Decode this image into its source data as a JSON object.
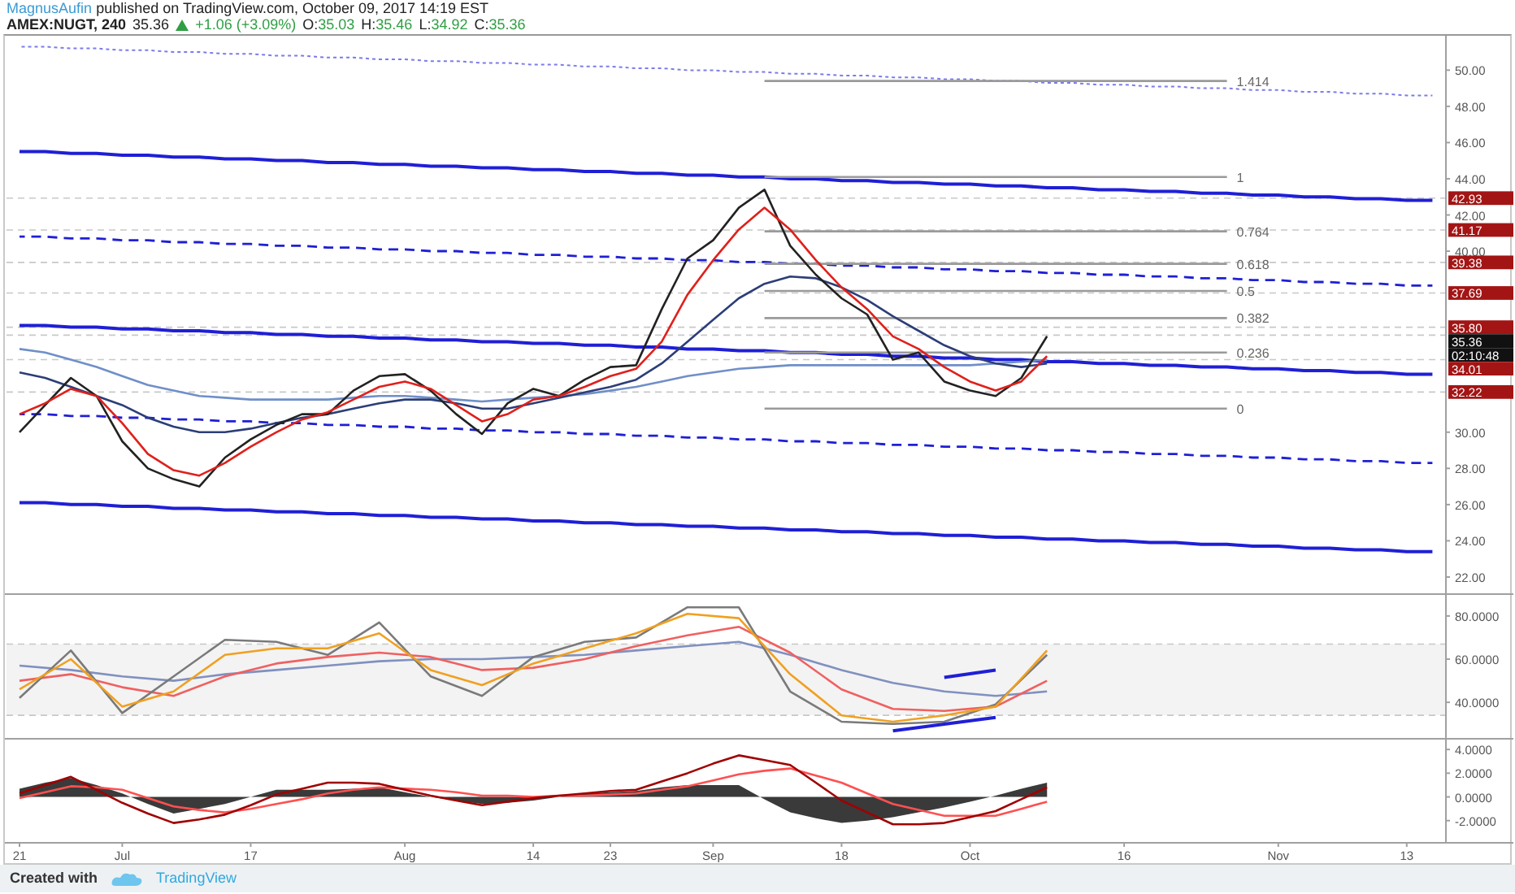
{
  "header": {
    "author": "MagnusAufin",
    "published": "published on TradingView.com, October 09, 2017 14:19 EST",
    "symbol": "AMEX:NUGT, 240",
    "last": "35.36",
    "change": "+1.06 (+3.09%)",
    "ohlc": [
      {
        "label": "O:",
        "value": "35.03"
      },
      {
        "label": "H:",
        "value": "35.46"
      },
      {
        "label": "L:",
        "value": "34.92"
      },
      {
        "label": "C:",
        "value": "35.36"
      }
    ]
  },
  "price_chart": {
    "tags": [
      {
        "kind": "level"
      },
      {
        "kind": "level"
      },
      {
        "kind": "level"
      },
      {
        "kind": "level"
      },
      {
        "kind": "level"
      },
      {
        "kind": "last"
      },
      {
        "kind": "level"
      },
      {
        "kind": "level"
      }
    ],
    "countdown": {
      "text": "02:10:48"
    },
    "chart_data": {
      "type": "line",
      "ylim": [
        21.1,
        51.9
      ],
      "yticks": [
        {
          "value": 22,
          "label": "22.00"
        },
        {
          "value": 24,
          "label": "24.00"
        },
        {
          "value": 26,
          "label": "26.00"
        },
        {
          "value": 28,
          "label": "28.00"
        },
        {
          "value": 30,
          "label": "30.00"
        },
        {
          "value": 40,
          "label": "40.00"
        },
        {
          "value": 42,
          "label": "42.00"
        },
        {
          "value": 44,
          "label": "44.00"
        },
        {
          "value": 46,
          "label": "46.00"
        },
        {
          "value": 48,
          "label": "48.00"
        },
        {
          "value": 50,
          "label": "50.00"
        }
      ],
      "categories": [
        null,
        null,
        null,
        null,
        null,
        null,
        null,
        null,
        null,
        null,
        null,
        null,
        null,
        null,
        null,
        null,
        null,
        null,
        null,
        null,
        null,
        null,
        null,
        null,
        null,
        null,
        null,
        null,
        null,
        null,
        null,
        null,
        null,
        null,
        null,
        null,
        null,
        null,
        null,
        null,
        null,
        null,
        null,
        null,
        null,
        null,
        null,
        null,
        null,
        null,
        null,
        null,
        null,
        null,
        null,
        null
      ],
      "series": [
        {
          "color": "#7b7bea",
          "line_style": "dotted",
          "values": [
            51.3,
            51.3,
            51.2,
            51.2,
            51.1,
            51.1,
            51.0,
            51.0,
            50.9,
            50.9,
            50.8,
            50.8,
            50.7,
            50.7,
            50.6,
            50.6,
            50.5,
            50.5,
            50.4,
            50.4,
            50.3,
            50.3,
            50.2,
            50.2,
            50.1,
            50.1,
            50.0,
            50.0,
            49.9,
            49.9,
            49.8,
            49.8,
            49.7,
            49.7,
            49.6,
            49.6,
            49.5,
            49.5,
            49.4,
            49.4,
            49.3,
            49.3,
            49.2,
            49.2,
            49.1,
            49.1,
            49.0,
            49.0,
            48.9,
            48.9,
            48.8,
            48.8,
            48.7,
            48.7,
            48.6,
            48.6
          ]
        },
        {
          "color": "#1f1fd6",
          "line_style": "solid",
          "values": [
            45.5,
            45.5,
            45.4,
            45.4,
            45.3,
            45.3,
            45.2,
            45.2,
            45.1,
            45.1,
            45.0,
            45.0,
            44.9,
            44.9,
            44.8,
            44.8,
            44.7,
            44.7,
            44.6,
            44.6,
            44.5,
            44.5,
            44.4,
            44.4,
            44.3,
            44.3,
            44.2,
            44.2,
            44.1,
            44.1,
            44.0,
            44.0,
            43.9,
            43.9,
            43.8,
            43.8,
            43.7,
            43.7,
            43.6,
            43.6,
            43.5,
            43.5,
            43.4,
            43.4,
            43.3,
            43.3,
            43.2,
            43.2,
            43.1,
            43.1,
            43.0,
            43.0,
            42.9,
            42.9,
            42.8,
            42.8
          ]
        },
        {
          "color": "#1f1fd6",
          "line_style": "dashed",
          "values": [
            40.8,
            40.8,
            40.7,
            40.7,
            40.6,
            40.6,
            40.5,
            40.5,
            40.4,
            40.4,
            40.3,
            40.3,
            40.2,
            40.2,
            40.1,
            40.1,
            40.0,
            40.0,
            39.9,
            39.9,
            39.8,
            39.8,
            39.7,
            39.7,
            39.6,
            39.6,
            39.5,
            39.5,
            39.4,
            39.4,
            39.3,
            39.3,
            39.2,
            39.2,
            39.1,
            39.1,
            39.0,
            39.0,
            38.9,
            38.9,
            38.8,
            38.8,
            38.7,
            38.7,
            38.6,
            38.6,
            38.5,
            38.5,
            38.4,
            38.4,
            38.3,
            38.3,
            38.2,
            38.2,
            38.1,
            38.1
          ]
        },
        {
          "color": "#1f1fd6",
          "line_style": "solid",
          "values": [
            35.9,
            35.9,
            35.8,
            35.8,
            35.7,
            35.7,
            35.6,
            35.6,
            35.5,
            35.5,
            35.4,
            35.4,
            35.3,
            35.3,
            35.2,
            35.2,
            35.1,
            35.1,
            35.0,
            35.0,
            34.9,
            34.9,
            34.8,
            34.8,
            34.7,
            34.7,
            34.6,
            34.6,
            34.5,
            34.5,
            34.4,
            34.4,
            34.3,
            34.3,
            34.2,
            34.2,
            34.1,
            34.1,
            34.0,
            34.0,
            33.9,
            33.9,
            33.8,
            33.8,
            33.7,
            33.7,
            33.6,
            33.6,
            33.5,
            33.5,
            33.4,
            33.4,
            33.3,
            33.3,
            33.2,
            33.2
          ]
        },
        {
          "color": "#1f1fd6",
          "line_style": "dashed",
          "values": [
            31.0,
            31.0,
            30.9,
            30.9,
            30.8,
            30.8,
            30.7,
            30.7,
            30.6,
            30.6,
            30.5,
            30.5,
            30.4,
            30.4,
            30.3,
            30.3,
            30.2,
            30.2,
            30.1,
            30.1,
            30.0,
            30.0,
            29.9,
            29.9,
            29.8,
            29.8,
            29.7,
            29.7,
            29.6,
            29.6,
            29.5,
            29.5,
            29.4,
            29.4,
            29.3,
            29.3,
            29.2,
            29.2,
            29.1,
            29.1,
            29.0,
            29.0,
            28.9,
            28.9,
            28.8,
            28.8,
            28.7,
            28.7,
            28.6,
            28.6,
            28.5,
            28.5,
            28.4,
            28.4,
            28.3,
            28.3
          ]
        },
        {
          "color": "#1f1fd6",
          "line_style": "solid",
          "values": [
            26.1,
            26.1,
            26.0,
            26.0,
            25.9,
            25.9,
            25.8,
            25.8,
            25.7,
            25.7,
            25.6,
            25.6,
            25.5,
            25.5,
            25.4,
            25.4,
            25.3,
            25.3,
            25.2,
            25.2,
            25.1,
            25.1,
            25.0,
            25.0,
            24.9,
            24.9,
            24.8,
            24.8,
            24.7,
            24.7,
            24.6,
            24.6,
            24.5,
            24.5,
            24.4,
            24.4,
            24.3,
            24.3,
            24.2,
            24.2,
            24.1,
            24.1,
            24.0,
            24.0,
            23.9,
            23.9,
            23.8,
            23.8,
            23.7,
            23.7,
            23.6,
            23.6,
            23.5,
            23.5,
            23.4,
            23.4
          ]
        },
        {
          "color": "#9a9a9a",
          "values": [
            null,
            null,
            null,
            null,
            null,
            null,
            null,
            null,
            null,
            null,
            null,
            null,
            null,
            null,
            null,
            null,
            null,
            null,
            null,
            null,
            null,
            null,
            null,
            null,
            null,
            null,
            null,
            null,
            null,
            49.4,
            49.4,
            49.4,
            49.4,
            49.4,
            49.4,
            49.4,
            49.4,
            49.4,
            49.4,
            49.4,
            49.4,
            49.4,
            49.4,
            49.4,
            49.4,
            49.4,
            49.4,
            49.4,
            null,
            null,
            null,
            null,
            null,
            null,
            null,
            null
          ]
        },
        {
          "color": "#9a9a9a",
          "values": [
            null,
            null,
            null,
            null,
            null,
            null,
            null,
            null,
            null,
            null,
            null,
            null,
            null,
            null,
            null,
            null,
            null,
            null,
            null,
            null,
            null,
            null,
            null,
            null,
            null,
            null,
            null,
            null,
            null,
            44.1,
            44.1,
            44.1,
            44.1,
            44.1,
            44.1,
            44.1,
            44.1,
            44.1,
            44.1,
            44.1,
            44.1,
            44.1,
            44.1,
            44.1,
            44.1,
            44.1,
            44.1,
            44.1,
            null,
            null,
            null,
            null,
            null,
            null,
            null,
            null
          ]
        },
        {
          "color": "#9a9a9a",
          "values": [
            null,
            null,
            null,
            null,
            null,
            null,
            null,
            null,
            null,
            null,
            null,
            null,
            null,
            null,
            null,
            null,
            null,
            null,
            null,
            null,
            null,
            null,
            null,
            null,
            null,
            null,
            null,
            null,
            null,
            41.1,
            41.1,
            41.1,
            41.1,
            41.1,
            41.1,
            41.1,
            41.1,
            41.1,
            41.1,
            41.1,
            41.1,
            41.1,
            41.1,
            41.1,
            41.1,
            41.1,
            41.1,
            41.1,
            null,
            null,
            null,
            null,
            null,
            null,
            null,
            null
          ]
        },
        {
          "color": "#9a9a9a",
          "values": [
            null,
            null,
            null,
            null,
            null,
            null,
            null,
            null,
            null,
            null,
            null,
            null,
            null,
            null,
            null,
            null,
            null,
            null,
            null,
            null,
            null,
            null,
            null,
            null,
            null,
            null,
            null,
            null,
            null,
            39.3,
            39.3,
            39.3,
            39.3,
            39.3,
            39.3,
            39.3,
            39.3,
            39.3,
            39.3,
            39.3,
            39.3,
            39.3,
            39.3,
            39.3,
            39.3,
            39.3,
            39.3,
            39.3,
            null,
            null,
            null,
            null,
            null,
            null,
            null,
            null
          ]
        },
        {
          "color": "#9a9a9a",
          "values": [
            null,
            null,
            null,
            null,
            null,
            null,
            null,
            null,
            null,
            null,
            null,
            null,
            null,
            null,
            null,
            null,
            null,
            null,
            null,
            null,
            null,
            null,
            null,
            null,
            null,
            null,
            null,
            null,
            null,
            37.8,
            37.8,
            37.8,
            37.8,
            37.8,
            37.8,
            37.8,
            37.8,
            37.8,
            37.8,
            37.8,
            37.8,
            37.8,
            37.8,
            37.8,
            37.8,
            37.8,
            37.8,
            37.8,
            null,
            null,
            null,
            null,
            null,
            null,
            null,
            null
          ]
        },
        {
          "color": "#9a9a9a",
          "values": [
            null,
            null,
            null,
            null,
            null,
            null,
            null,
            null,
            null,
            null,
            null,
            null,
            null,
            null,
            null,
            null,
            null,
            null,
            null,
            null,
            null,
            null,
            null,
            null,
            null,
            null,
            null,
            null,
            null,
            36.3,
            36.3,
            36.3,
            36.3,
            36.3,
            36.3,
            36.3,
            36.3,
            36.3,
            36.3,
            36.3,
            36.3,
            36.3,
            36.3,
            36.3,
            36.3,
            36.3,
            36.3,
            36.3,
            null,
            null,
            null,
            null,
            null,
            null,
            null,
            null
          ]
        },
        {
          "color": "#9a9a9a",
          "values": [
            null,
            null,
            null,
            null,
            null,
            null,
            null,
            null,
            null,
            null,
            null,
            null,
            null,
            null,
            null,
            null,
            null,
            null,
            null,
            null,
            null,
            null,
            null,
            null,
            null,
            null,
            null,
            null,
            null,
            34.4,
            34.4,
            34.4,
            34.4,
            34.4,
            34.4,
            34.4,
            34.4,
            34.4,
            34.4,
            34.4,
            34.4,
            34.4,
            34.4,
            34.4,
            34.4,
            34.4,
            34.4,
            34.4,
            null,
            null,
            null,
            null,
            null,
            null,
            null,
            null
          ]
        },
        {
          "color": "#9a9a9a",
          "values": [
            null,
            null,
            null,
            null,
            null,
            null,
            null,
            null,
            null,
            null,
            null,
            null,
            null,
            null,
            null,
            null,
            null,
            null,
            null,
            null,
            null,
            null,
            null,
            null,
            null,
            null,
            null,
            null,
            null,
            31.3,
            31.3,
            31.3,
            31.3,
            31.3,
            31.3,
            31.3,
            31.3,
            31.3,
            31.3,
            31.3,
            31.3,
            31.3,
            31.3,
            31.3,
            31.3,
            31.3,
            31.3,
            31.3,
            null,
            null,
            null,
            null,
            null,
            null,
            null,
            null
          ]
        },
        {
          "color": "#6f8fc8",
          "values": [
            34.6,
            34.4,
            34.0,
            33.6,
            33.1,
            32.6,
            32.3,
            32.0,
            31.9,
            31.8,
            31.8,
            31.8,
            31.8,
            31.9,
            32.0,
            32.0,
            31.9,
            31.8,
            31.7,
            31.8,
            31.9,
            32.0,
            32.1,
            32.3,
            32.5,
            32.8,
            33.1,
            33.3,
            33.5,
            33.6,
            33.7,
            33.7,
            33.7,
            33.7,
            33.7,
            33.7,
            33.7,
            33.7,
            33.8,
            33.9,
            34.0,
            null,
            null,
            null,
            null,
            null,
            null,
            null,
            null,
            null,
            null,
            null,
            null,
            null,
            null,
            null
          ]
        },
        {
          "color": "#2c3e78",
          "values": [
            33.3,
            33.0,
            32.5,
            32.0,
            31.5,
            30.8,
            30.3,
            30.0,
            30.0,
            30.2,
            30.5,
            30.8,
            31.0,
            31.3,
            31.6,
            31.8,
            31.8,
            31.6,
            31.3,
            31.3,
            31.6,
            31.9,
            32.2,
            32.5,
            32.9,
            33.8,
            35.0,
            36.2,
            37.4,
            38.2,
            38.6,
            38.5,
            38.0,
            37.3,
            36.4,
            35.6,
            34.8,
            34.2,
            33.8,
            33.6,
            33.8,
            null,
            null,
            null,
            null,
            null,
            null,
            null,
            null,
            null,
            null,
            null,
            null,
            null,
            null,
            null
          ]
        },
        {
          "color": "#222222",
          "values": [
            30.0,
            31.5,
            33.0,
            32.0,
            29.5,
            28.0,
            27.4,
            27.0,
            28.6,
            29.6,
            30.4,
            31.0,
            31.0,
            32.3,
            33.1,
            33.2,
            32.3,
            31.0,
            29.9,
            31.6,
            32.4,
            32.0,
            32.9,
            33.6,
            33.7,
            36.8,
            39.6,
            40.6,
            42.4,
            43.4,
            40.3,
            38.7,
            37.4,
            36.5,
            34.0,
            34.4,
            32.8,
            32.3,
            32.0,
            33.0,
            35.3,
            null,
            null,
            null,
            null,
            null,
            null,
            null,
            null,
            null,
            null,
            null,
            null,
            null,
            null,
            null
          ]
        },
        {
          "color": "#e0201b",
          "values": [
            31.0,
            31.6,
            32.4,
            32.0,
            30.5,
            28.8,
            27.9,
            27.6,
            28.3,
            29.2,
            30.0,
            30.7,
            31.1,
            31.8,
            32.5,
            32.8,
            32.4,
            31.5,
            30.6,
            31.0,
            31.8,
            32.0,
            32.5,
            33.1,
            33.5,
            35.0,
            37.6,
            39.5,
            41.2,
            42.4,
            41.2,
            39.5,
            38.0,
            36.8,
            35.3,
            34.6,
            33.6,
            32.8,
            32.3,
            32.8,
            34.2,
            null,
            null,
            null,
            null,
            null,
            null,
            null,
            null,
            null,
            null,
            null,
            null,
            null,
            null,
            null
          ]
        }
      ],
      "annotations": [
        "1.414",
        "1",
        "0.764",
        "0.618",
        "0.5",
        "0.382",
        "0.236",
        "0"
      ],
      "ref_lines": [
        {
          "axis": "y",
          "value": 42.93,
          "label": "42.93"
        },
        {
          "axis": "y",
          "value": 41.17,
          "label": "41.17"
        },
        {
          "axis": "y",
          "value": 39.38,
          "label": "39.38"
        },
        {
          "axis": "y",
          "value": 37.69,
          "label": "37.69"
        },
        {
          "axis": "y",
          "value": 35.8,
          "label": "35.80"
        },
        {
          "axis": "y",
          "value": 35.36,
          "label": "35.36"
        },
        {
          "axis": "y",
          "value": 34.01,
          "label": "34.01"
        },
        {
          "axis": "y",
          "value": 32.22,
          "label": "32.22"
        }
      ]
    }
  },
  "oscillator": {
    "chart_data": {
      "type": "line",
      "ylim": [
        23.5,
        90.5
      ],
      "yticks": [
        {
          "value": 40,
          "label": "40.0000"
        },
        {
          "value": 60,
          "label": "60.0000"
        },
        {
          "value": 80,
          "label": "80.0000"
        }
      ],
      "bands": [
        {
          "axis": "y",
          "from": 34,
          "to": 67
        }
      ],
      "ref_lines": [
        {
          "axis": "y",
          "value": 67
        },
        {
          "axis": "y",
          "value": 34
        }
      ],
      "categories": [
        null,
        null,
        null,
        null,
        null,
        null,
        null,
        null,
        null,
        null,
        null,
        null,
        null,
        null,
        null,
        null,
        null,
        null,
        null,
        null,
        null,
        null,
        null,
        null,
        null,
        null,
        null,
        null
      ],
      "series": [
        {
          "color": "#8090c0",
          "values": [
            57,
            55,
            52,
            50,
            53,
            55,
            57,
            59,
            60,
            60,
            61,
            62,
            64,
            66,
            68,
            62,
            55,
            49,
            45,
            43,
            45,
            null,
            null,
            null,
            null,
            null,
            null,
            null
          ]
        },
        {
          "color": "#f06060",
          "values": [
            50,
            53,
            47,
            43,
            52,
            58,
            61,
            63,
            61,
            55,
            56,
            60,
            66,
            71,
            75,
            63,
            46,
            37,
            36,
            38,
            50,
            null,
            null,
            null,
            null,
            null,
            null,
            null
          ]
        },
        {
          "color": "#7a7a7a",
          "values": [
            42,
            64,
            35,
            52,
            69,
            68,
            62,
            77,
            52,
            43,
            61,
            68,
            70,
            84,
            84,
            45,
            31,
            30,
            31,
            39,
            62,
            null,
            null,
            null,
            null,
            null,
            null,
            null
          ]
        },
        {
          "color": "#f0a020",
          "values": [
            46,
            60,
            38,
            45,
            62,
            65,
            65,
            72,
            55,
            48,
            58,
            65,
            72,
            81,
            79,
            53,
            34,
            31,
            34,
            38,
            64,
            null,
            null,
            null,
            null,
            null,
            null,
            null
          ]
        },
        {
          "color": "#1f1fd6",
          "line_style": "solid",
          "values": [
            null,
            null,
            null,
            null,
            null,
            null,
            null,
            null,
            null,
            null,
            null,
            null,
            null,
            null,
            null,
            null,
            null,
            null,
            51.5,
            55,
            null,
            null,
            null,
            null,
            null,
            null,
            null,
            null
          ]
        },
        {
          "color": "#1f1fd6",
          "line_style": "solid",
          "values": [
            null,
            null,
            null,
            null,
            null,
            null,
            null,
            null,
            null,
            null,
            null,
            null,
            null,
            null,
            null,
            null,
            null,
            26.8,
            29.9,
            33.0,
            null,
            null,
            null,
            null,
            null,
            null,
            null,
            null
          ]
        }
      ]
    }
  },
  "macd": {
    "chart_data": {
      "type": "line",
      "ylim": [
        -3.8,
        4.97
      ],
      "yticks": [
        {
          "value": -2,
          "label": "-2.0000"
        },
        {
          "value": 0,
          "label": "0.0000"
        },
        {
          "value": 2,
          "label": "2.0000"
        },
        {
          "value": 4,
          "label": "4.0000"
        }
      ],
      "categories": [
        "21",
        null,
        null,
        null,
        "Jul",
        null,
        null,
        null,
        null,
        "17",
        null,
        null,
        null,
        null,
        null,
        "Aug",
        null,
        null,
        null,
        null,
        "14",
        null,
        null,
        "23",
        null,
        null,
        null,
        "Sep",
        null,
        null,
        null,
        null,
        "18",
        null,
        null,
        null,
        null,
        "Oct",
        null,
        null,
        null,
        null,
        null,
        "16",
        null,
        null,
        null,
        null,
        null,
        "Nov",
        null,
        null,
        null,
        null,
        "13",
        null
      ],
      "series": [
        {
          "type": "area",
          "color": "#3a3a3a",
          "values": [
            0.7,
            1.2,
            1.6,
            1.0,
            0.3,
            -0.6,
            -1.4,
            -1.0,
            -0.6,
            0,
            0.6,
            0.6,
            0.6,
            0.7,
            0.8,
            0.4,
            0,
            -0.3,
            -0.6,
            -0.5,
            -0.3,
            0,
            0.3,
            0.4,
            0.5,
            0.8,
            1.0,
            1.0,
            1.0,
            -0.2,
            -1.3,
            -1.8,
            -2.2,
            -2.0,
            -1.7,
            -1.3,
            -0.9,
            -0.4,
            0.1,
            0.7,
            1.2,
            null,
            null,
            null,
            null,
            null,
            null,
            null,
            null,
            null,
            null,
            null,
            null,
            null,
            null,
            null
          ]
        },
        {
          "color": "#ff5050",
          "values": [
            -0.1,
            0.4,
            0.9,
            0.8,
            0.6,
            -0.1,
            -0.8,
            -1.1,
            -1.3,
            -1.0,
            -0.6,
            -0.2,
            0.3,
            0.6,
            0.8,
            0.7,
            0.6,
            0.4,
            0.1,
            0.1,
            0,
            0.1,
            0.1,
            0.2,
            0.3,
            0.6,
            0.9,
            1.4,
            1.9,
            2.2,
            2.4,
            1.8,
            1.2,
            0.3,
            -0.6,
            -1.1,
            -1.6,
            -1.6,
            -1.6,
            -1.0,
            -0.4,
            null,
            null,
            null,
            null,
            null,
            null,
            null,
            null,
            null,
            null,
            null,
            null,
            null,
            null,
            null
          ]
        },
        {
          "color": "#a00000",
          "values": [
            0.3,
            1.0,
            1.7,
            0.6,
            -0.5,
            -1.4,
            -2.2,
            -1.9,
            -1.5,
            -0.7,
            0.2,
            0.7,
            1.2,
            1.2,
            1.1,
            0.6,
            0.1,
            -0.3,
            -0.7,
            -0.4,
            -0.1,
            0.1,
            0.3,
            0.5,
            0.6,
            1.3,
            2.0,
            2.8,
            3.5,
            3.1,
            2.7,
            1.2,
            -0.3,
            -1.3,
            -2.3,
            -2.3,
            -2.2,
            -1.7,
            -1.2,
            -0.2,
            0.8,
            null,
            null,
            null,
            null,
            null,
            null,
            null,
            null,
            null,
            null,
            null,
            null,
            null,
            null,
            null
          ]
        }
      ]
    }
  },
  "footer": {
    "created_with": "Created with",
    "brand": "TradingView"
  }
}
